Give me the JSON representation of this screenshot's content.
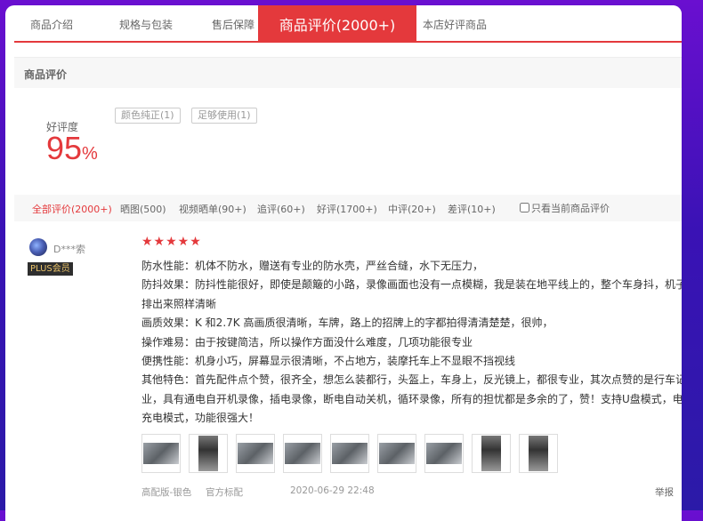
{
  "tabs": [
    {
      "label": "商品介绍"
    },
    {
      "label": "规格与包装"
    },
    {
      "label": "售后保障"
    },
    {
      "label": "商品评价(2000+)"
    },
    {
      "label": "本店好评商品"
    }
  ],
  "section_title": "商品评价",
  "rating": {
    "label": "好评度",
    "value": "95",
    "unit": "%"
  },
  "tags": [
    "颜色纯正(1)",
    "足够使用(1)"
  ],
  "filters": [
    {
      "label": "全部评价(2000+)"
    },
    {
      "label": "晒图(500)"
    },
    {
      "label": "视频晒单(90+)"
    },
    {
      "label": "追评(60+)"
    },
    {
      "label": "好评(1700+)"
    },
    {
      "label": "中评(20+)"
    },
    {
      "label": "差评(10+)"
    }
  ],
  "only_current_label": "只看当前商品评价",
  "review": {
    "user": "D***索",
    "badge": "PLUS会员",
    "stars": "★★★★★",
    "lines": [
      "防水性能：机体不防水，赠送有专业的防水壳，严丝合缝，水下无压力，",
      "防抖效果：防抖性能很好，即使是颠簸的小路，录像画面也没有一点模糊，我是装在地平线上的，整个车身抖，机子",
      "排出来照样清晰",
      "画质效果：K 和2.7K 高画质很清晰，车牌，路上的招牌上的字都拍得清清楚楚，很帅，",
      "操作难易：由于按键简洁，所以操作方面没什么难度，几项功能很专业",
      "便携性能：机身小巧，屏幕显示很清晰，不占地方，装摩托车上不显眼不挡视线",
      "其他特色：首先配件点个赞，很齐全，想怎么装都行，头盔上，车身上，反光镜上，都很专业，其次点赞的是行车记",
      "业，具有通电自开机录像，插电录像，断电自动关机，循环录像，所有的担忧都是多余的了，赞！支持U盘模式，电",
      "充电模式，功能很强大！"
    ],
    "variant": "高配版-银色",
    "spec": "官方标配",
    "date": "2020-06-29 22:48",
    "report": "举报"
  }
}
